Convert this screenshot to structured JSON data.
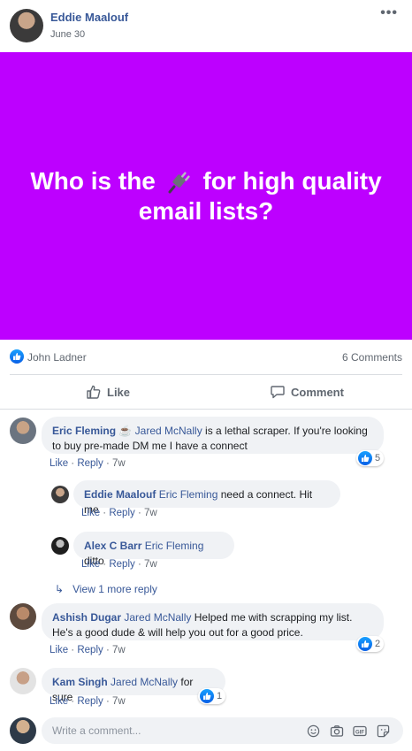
{
  "post": {
    "author": "Eddie Maalouf",
    "date": "June 30",
    "more_label": "•••",
    "banner": {
      "text_before": "Who is the",
      "emoji": "plug",
      "text_after": "for high quality email lists?",
      "background": "#bd00ff"
    }
  },
  "stats": {
    "reactor": "John Ladner",
    "comments_count": "6 Comments"
  },
  "actions": {
    "like_label": "Like",
    "comment_label": "Comment"
  },
  "comments": [
    {
      "author": "Eric Fleming",
      "emoji": "coffee",
      "mention": "Jared McNally",
      "text": "is a lethal scraper. If you're looking to buy pre-made DM me I have a connect",
      "like": "Like",
      "reply": "Reply",
      "age": "7w",
      "reactions": "5"
    },
    {
      "author": "Eddie Maalouf",
      "mention": "Eric Fleming",
      "text": "need a connect. Hit me",
      "like": "Like",
      "reply": "Reply",
      "age": "7w"
    },
    {
      "author": "Alex C Barr",
      "mention": "Eric Fleming",
      "text": "ditto",
      "like": "Like",
      "reply": "Reply",
      "age": "7w"
    },
    {
      "author": "Ashish Dugar",
      "mention": "Jared McNally",
      "text": "Helped me with scrapping my list. He's a good dude & will help you out for a good price.",
      "like": "Like",
      "reply": "Reply",
      "age": "7w",
      "reactions": "2"
    },
    {
      "author": "Kam Singh",
      "mention": "Jared McNally",
      "text": "for sure",
      "like": "Like",
      "reply": "Reply",
      "age": "7w",
      "reactions": "1"
    }
  ],
  "view_more": "View 1 more reply",
  "write_comment": {
    "placeholder": "Write a comment...",
    "icons": [
      "emoji-icon",
      "camera-icon",
      "gif-icon",
      "sticker-icon"
    ]
  },
  "colors": {
    "link": "#385898",
    "secondary_text": "#606770",
    "bubble": "#f0f2f5",
    "like_blue": "#1877f2"
  }
}
